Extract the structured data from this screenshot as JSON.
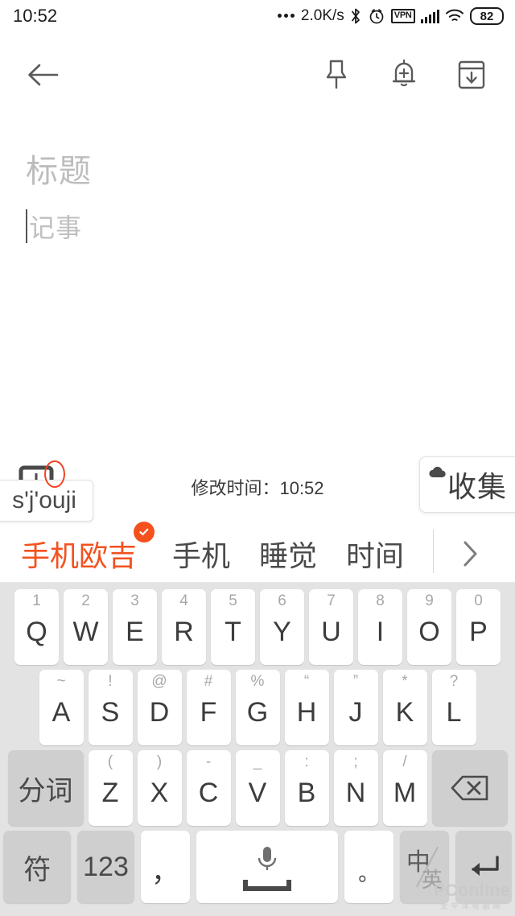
{
  "status_bar": {
    "clock": "10:52",
    "network_speed": "2.0K/s",
    "dots_icon": "more-dots-icon",
    "bluetooth_icon": "bluetooth-icon",
    "alarm_icon": "alarm-clock-icon",
    "vpn_label": "VPN",
    "signal_icon": "signal-bars-icon",
    "wifi_icon": "wifi-icon",
    "battery_level": "82"
  },
  "toolbar": {
    "back_icon": "back-arrow-icon",
    "pin_icon": "pin-icon",
    "reminder_icon": "bell-plus-icon",
    "archive_icon": "archive-download-icon"
  },
  "note": {
    "title_placeholder": "标题",
    "body_placeholder": "记事",
    "modify_time": "修改时间：10:52"
  },
  "collect_button": {
    "label": "收集",
    "icon": "cloud-icon"
  },
  "pinyin_popup": {
    "composition": "s'j'ouji",
    "icon": "keyboard-popup-icon"
  },
  "candidate_bar": {
    "items": [
      {
        "text": "手机欧吉",
        "selected": true,
        "badge": "check-badge"
      },
      {
        "text": "手机",
        "selected": false
      },
      {
        "text": "睡觉",
        "selected": false
      },
      {
        "text": "时间",
        "selected": false
      }
    ],
    "expand_icon": "chevron-right-icon"
  },
  "keyboard": {
    "row1": [
      {
        "sup": "1",
        "main": "Q"
      },
      {
        "sup": "2",
        "main": "W"
      },
      {
        "sup": "3",
        "main": "E"
      },
      {
        "sup": "4",
        "main": "R"
      },
      {
        "sup": "5",
        "main": "T"
      },
      {
        "sup": "6",
        "main": "Y"
      },
      {
        "sup": "7",
        "main": "U"
      },
      {
        "sup": "8",
        "main": "I"
      },
      {
        "sup": "9",
        "main": "O"
      },
      {
        "sup": "0",
        "main": "P"
      }
    ],
    "row2": [
      {
        "sup": "~",
        "main": "A"
      },
      {
        "sup": "!",
        "main": "S"
      },
      {
        "sup": "@",
        "main": "D"
      },
      {
        "sup": "#",
        "main": "F"
      },
      {
        "sup": "%",
        "main": "G"
      },
      {
        "sup": "“",
        "main": "H"
      },
      {
        "sup": "”",
        "main": "J"
      },
      {
        "sup": "*",
        "main": "K"
      },
      {
        "sup": "?",
        "main": "L"
      }
    ],
    "row3": {
      "segment_key": "分词",
      "letters": [
        {
          "sup": "(",
          "main": "Z"
        },
        {
          "sup": ")",
          "main": "X"
        },
        {
          "sup": "-",
          "main": "C"
        },
        {
          "sup": "_",
          "main": "V"
        },
        {
          "sup": ":",
          "main": "B"
        },
        {
          "sup": ";",
          "main": "N"
        },
        {
          "sup": "/",
          "main": "M"
        }
      ],
      "backspace_icon": "backspace-icon"
    },
    "row4": {
      "symbol_key": "符",
      "numeric_key": "123",
      "comma_key": "，",
      "space_icon": "microphone-icon",
      "period_key": "。",
      "lang_zh": "中",
      "lang_en": "英",
      "enter_icon": "enter-icon"
    }
  },
  "watermark": {
    "text": "PConline",
    "sub": "太平洋电脑网"
  },
  "colors": {
    "accent": "#f4511e",
    "keyboard_bg": "#e3e3e3",
    "key_bg": "#ffffff",
    "fn_key_bg": "#cfcfcf",
    "placeholder": "#bdbdbd"
  }
}
